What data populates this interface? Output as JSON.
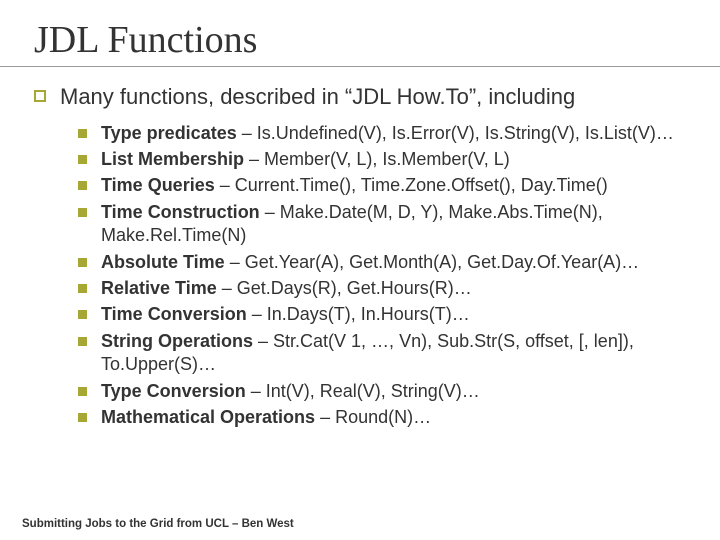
{
  "title": "JDL Functions",
  "lead": "Many functions, described in “JDL How.To”, including",
  "items": [
    {
      "name": "Type predicates",
      "body": " – Is.Undefined(V), Is.Error(V), Is.String(V), Is.List(V)…"
    },
    {
      "name": "List Membership",
      "body": " – Member(V, L), Is.Member(V, L)"
    },
    {
      "name": "Time Queries",
      "body": " – Current.Time(), Time.Zone.Offset(), Day.Time()"
    },
    {
      "name": "Time Construction",
      "body": " – Make.Date(M, D, Y), Make.Abs.Time(N), Make.Rel.Time(N)"
    },
    {
      "name": "Absolute Time",
      "body": " – Get.Year(A), Get.Month(A), Get.Day.Of.Year(A)…"
    },
    {
      "name": "Relative Time",
      "body": " – Get.Days(R), Get.Hours(R)…"
    },
    {
      "name": "Time Conversion",
      "body": " – In.Days(T), In.Hours(T)…"
    },
    {
      "name": "String Operations",
      "body": " – Str.Cat(V 1, …, Vn), Sub.Str(S, offset, [, len]), To.Upper(S)…"
    },
    {
      "name": "Type Conversion",
      "body": " – Int(V), Real(V), String(V)…"
    },
    {
      "name": "Mathematical Operations",
      "body": " – Round(N)…"
    }
  ],
  "footer": "Submitting Jobs to the Grid from UCL – Ben West"
}
